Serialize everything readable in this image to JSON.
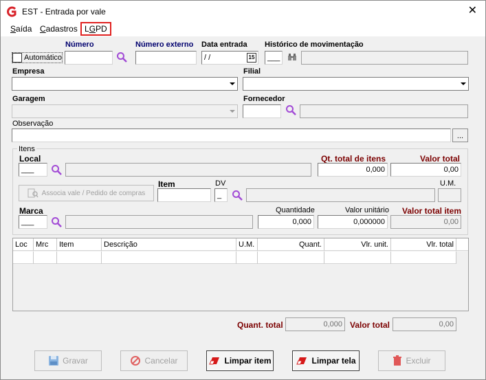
{
  "window": {
    "title": "EST - Entrada por vale",
    "close_glyph": "✕"
  },
  "menu": {
    "saida_first": "S",
    "saida_rest": "aída",
    "cad_first": "C",
    "cad_rest": "adastros",
    "lgpd_pre": "L",
    "lgpd_u": "G",
    "lgpd_post": "PD"
  },
  "labels": {
    "automatico": "Automático",
    "numero": "Número",
    "numero_externo": "Número externo",
    "data_entrada": "Data entrada",
    "historico": "Histórico de movimentação",
    "empresa": "Empresa",
    "filial": "Filial",
    "garagem": "Garagem",
    "fornecedor": "Fornecedor",
    "observacao": "Observação",
    "itens": "Itens",
    "local": "Local",
    "qt_total_itens": "Qt. total de itens",
    "valor_total": "Valor total",
    "item": "Item",
    "dv": "DV",
    "um": "U.M.",
    "marca": "Marca",
    "quantidade": "Quantidade",
    "valor_unitario": "Valor unitário",
    "valor_total_item": "Valor total item",
    "quant_total": "Quant. total",
    "valor_total_bottom": "Valor total"
  },
  "values": {
    "data_entrada": " / /",
    "calendar": "15",
    "historico_code": "___",
    "local_code": "___",
    "dv": "_",
    "marca_code": "___",
    "qt_total_itens": "0,000",
    "valor_total": "0,00",
    "quantidade": "0,000",
    "valor_unitario": "0,000000",
    "valor_total_item": "0,00",
    "quant_total": "0,000",
    "valor_total_bottom": "0,00",
    "obs_button": "..."
  },
  "buttons": {
    "associa": "Associa vale / Pedido de compras",
    "gravar": "Gravar",
    "cancelar": "Cancelar",
    "limpar_item": "Limpar item",
    "limpar_tela": "Limpar tela",
    "excluir": "Excluir"
  },
  "grid": {
    "columns": [
      "Loc",
      "Mrc",
      "Item",
      "Descrição",
      "U.M.",
      "Quant.",
      "Vlr. unit.",
      "Vlr. total"
    ]
  },
  "colors": {
    "accent_navy": "#00006e",
    "accent_maroon": "#7b0000",
    "lgpd_highlight": "#e0201f",
    "search_icon": "#a24bd6"
  }
}
